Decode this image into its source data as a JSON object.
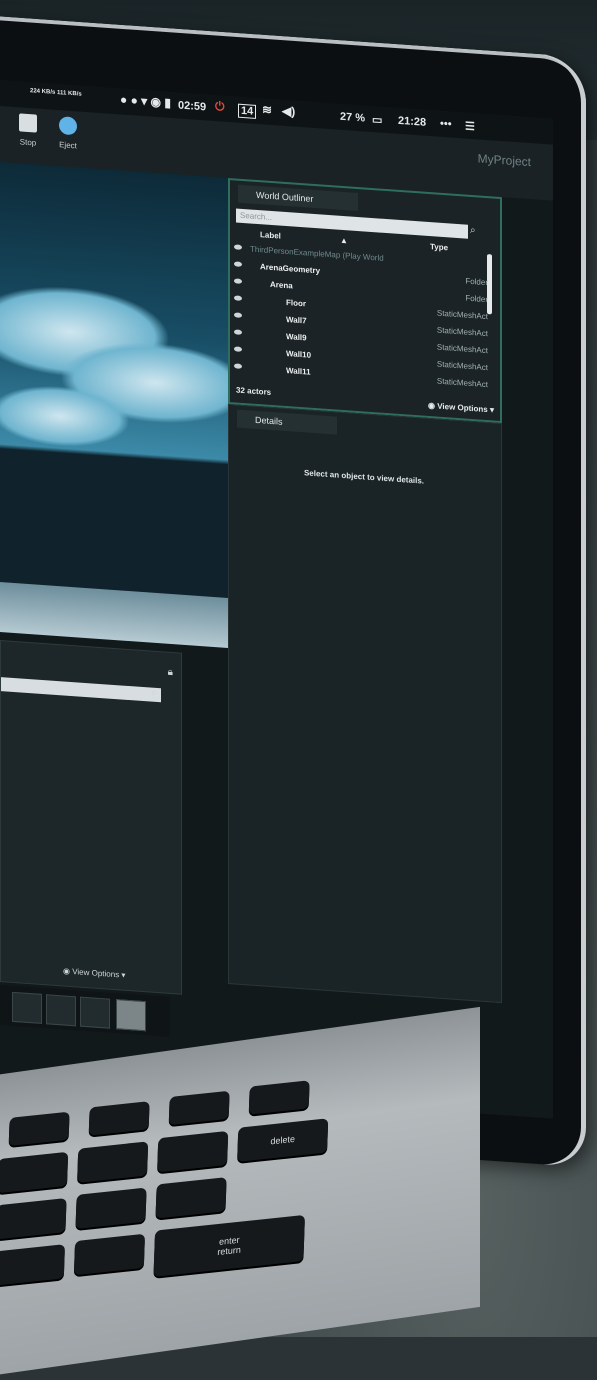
{
  "menubar": {
    "net": "224 KB/s 111 KB/s",
    "timer": "02:59",
    "badge": "14",
    "battery": "27 %",
    "clock": "21:28"
  },
  "toolbar": {
    "stop_label": "Stop",
    "eject_label": "Eject",
    "project": "MyProject"
  },
  "world_outliner": {
    "title": "World Outliner",
    "search_placeholder": "Search...",
    "col_label": "Label",
    "col_type": "Type",
    "rows": [
      {
        "label": "ThirdPersonExampleMap (Play World",
        "type": ""
      },
      {
        "label": "ArenaGeometry",
        "type": "Folder"
      },
      {
        "label": "Arena",
        "type": "Folder"
      },
      {
        "label": "Floor",
        "type": "StaticMeshAct"
      },
      {
        "label": "Wall7",
        "type": "StaticMeshAct"
      },
      {
        "label": "Wall9",
        "type": "StaticMeshAct"
      },
      {
        "label": "Wall10",
        "type": "StaticMeshAct"
      },
      {
        "label": "Wall11",
        "type": "StaticMeshAct"
      }
    ],
    "actor_count": "32 actors",
    "view_options": "View Options"
  },
  "details": {
    "title": "Details",
    "empty_message": "Select an object to view details."
  },
  "content_browser": {
    "view_options": "View Options"
  },
  "keyboard": {
    "delete": "delete",
    "enter": "enter",
    "return": "return"
  }
}
